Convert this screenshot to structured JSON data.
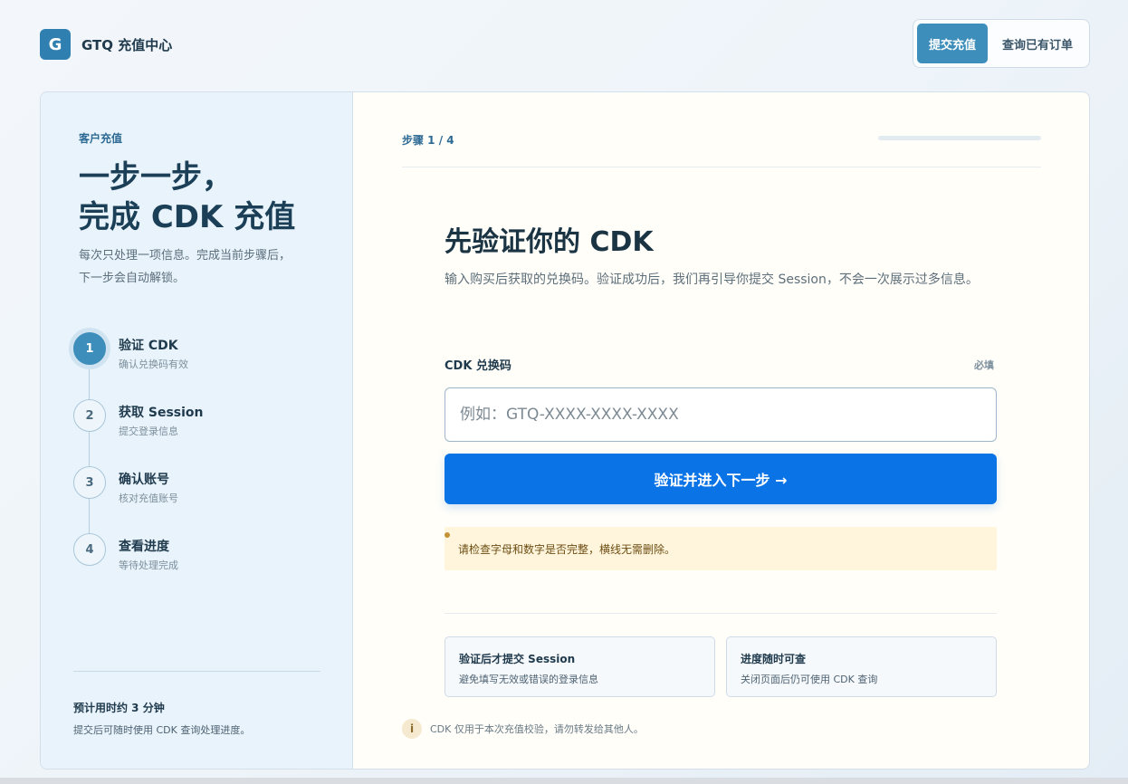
{
  "header": {
    "logo_letter": "G",
    "brand": "GTQ 充值中心",
    "nav": [
      {
        "label": "提交充值",
        "active": true
      },
      {
        "label": "查询已有订单",
        "active": false
      }
    ]
  },
  "sidebar": {
    "eyebrow": "客户充值",
    "title": "一步一步，\n完成 CDK 充值",
    "description": "每次只处理一项信息。完成当前步骤后，\n下一步会自动解锁。",
    "steps": [
      {
        "num": "1",
        "title": "验证 CDK",
        "sub": "确认兑换码有效",
        "active": true
      },
      {
        "num": "2",
        "title": "获取 Session",
        "sub": "提交登录信息",
        "active": false
      },
      {
        "num": "3",
        "title": "确认账号",
        "sub": "核对充值账号",
        "active": false
      },
      {
        "num": "4",
        "title": "查看进度",
        "sub": "等待处理完成",
        "active": false
      }
    ],
    "footer_title": "预计用时约 3 分钟",
    "footer_sub": "提交后可随时使用 CDK 查询处理进度。"
  },
  "main": {
    "step_indicator": "步骤 1 / 4",
    "progress_fraction": 0,
    "title": "先验证你的 CDK",
    "description": "输入购买后获取的兑换码。验证成功后，我们再引导你提交 Session，不会一次展示过多信息。",
    "field_label": "CDK 兑换码",
    "field_required": "必填",
    "input_placeholder": "例如：GTQ-XXXX-XXXX-XXXX",
    "input_value": "",
    "submit_label": "验证并进入下一步 →",
    "hint": "请检查字母和数字是否完整，横线无需删除。",
    "info_cards": [
      {
        "title": "验证后才提交 Session",
        "sub": "避免填写无效或错误的登录信息"
      },
      {
        "title": "进度随时可查",
        "sub": "关闭页面后仍可使用 CDK 查询"
      }
    ],
    "footnote_icon": "info-icon",
    "footnote_icon_glyph": "i",
    "footnote": "CDK 仅用于本次充值校验，请勿转发给其他人。"
  },
  "colors": {
    "accent": "#3e8ebb",
    "primary_button": "#0a73e5",
    "hint_bg": "#fff5dc"
  }
}
